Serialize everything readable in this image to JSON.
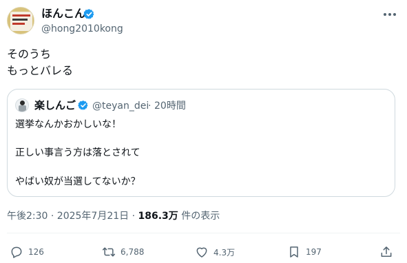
{
  "author": {
    "display_name": "ほんこん",
    "handle": "@hong2010kong"
  },
  "post": {
    "lines": [
      "そのうち",
      "もっとバレる"
    ]
  },
  "quoted": {
    "display_name": "楽しんご",
    "handle": "@teyan_dei",
    "separator": "·",
    "time": "20時間",
    "lines": [
      "選挙なんかおかしいな！",
      "正しい事言う方は落とされて",
      "やばい奴が当選してないか？"
    ]
  },
  "meta": {
    "time": "午後2:30 · 2025年7月21日 · ",
    "views_count": "186.3万",
    "views_label": " 件の表示"
  },
  "actions": {
    "replies": "126",
    "reposts": "6,788",
    "likes": "4.3万",
    "bookmarks": "197"
  },
  "colors": {
    "verified": "#1d9bf0",
    "secondary_text": "#536471",
    "border": "#cfd9de"
  }
}
